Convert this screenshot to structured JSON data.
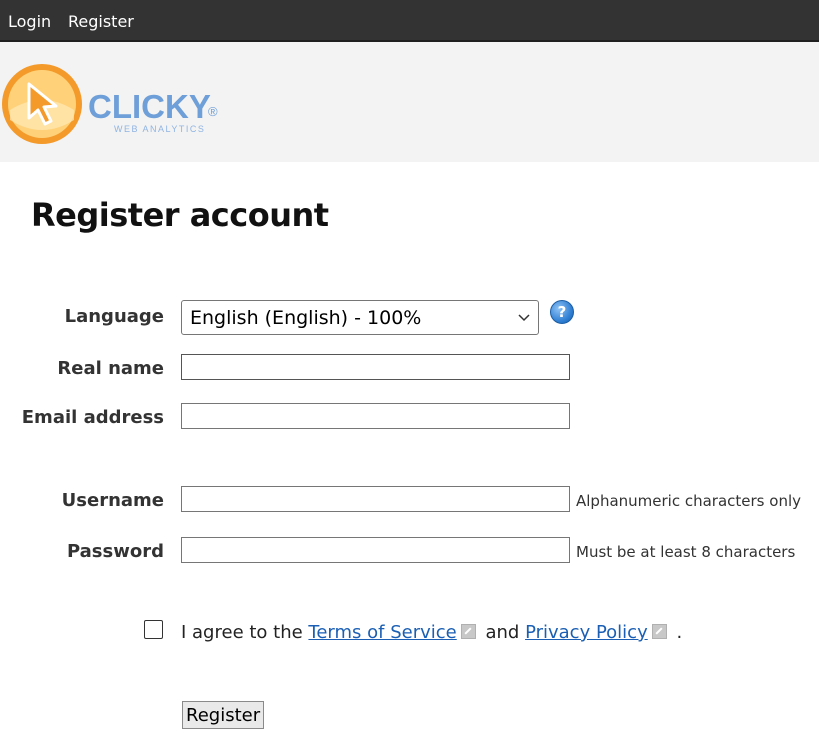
{
  "nav": {
    "login": "Login",
    "register": "Register"
  },
  "logo": {
    "name": "CLICKY",
    "tagline": "WEB ANALYTICS",
    "registered_mark": "®"
  },
  "page_title": "Register account",
  "form": {
    "language": {
      "label": "Language",
      "selected": "English (English) - 100%",
      "help": "?"
    },
    "real_name": {
      "label": "Real name",
      "value": ""
    },
    "email": {
      "label": "Email address",
      "value": ""
    },
    "username": {
      "label": "Username",
      "value": "",
      "hint": "Alphanumeric characters only"
    },
    "password": {
      "label": "Password",
      "value": "",
      "hint": "Must be at least 8 characters"
    },
    "agree": {
      "prefix": "I agree to the ",
      "terms_link": "Terms of Service",
      "middle": " and ",
      "privacy_link": "Privacy Policy",
      "suffix": " .",
      "checked": false
    },
    "submit_label": "Register"
  },
  "icons": {
    "external_link": "external-link-icon",
    "dropdown": "chevron-down-icon",
    "help": "help-icon",
    "cursor": "cursor-icon"
  },
  "colors": {
    "topbar": "#333333",
    "header_bg": "#f3f3f3",
    "link": "#1a5fb4",
    "logo_orange": "#f39a2b",
    "logo_blue": "#6f9fd8"
  }
}
